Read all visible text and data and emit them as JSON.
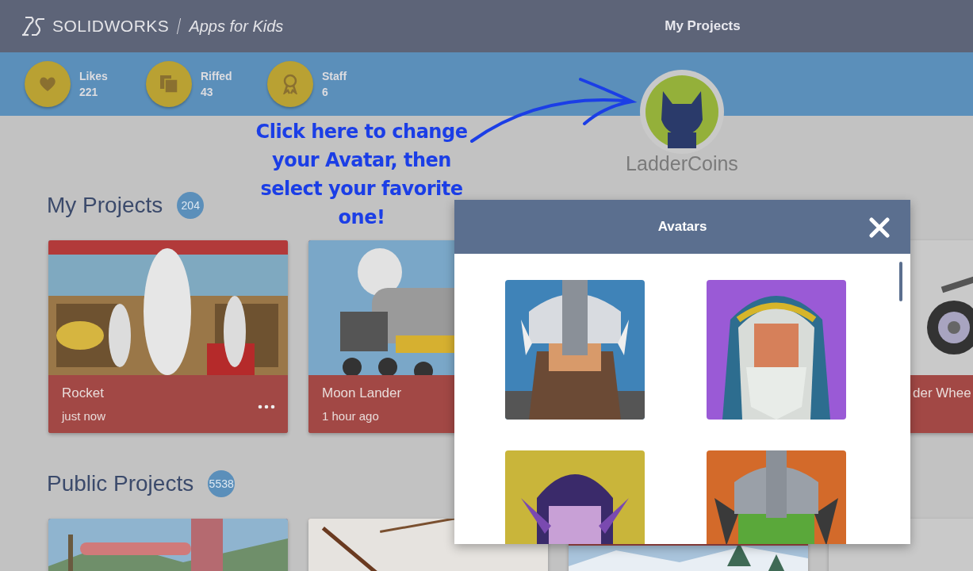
{
  "header": {
    "logo": "**SOLID**WORKS",
    "subtitle": "Apps for Kids",
    "title": "My Projects"
  },
  "stats": [
    {
      "kind": "likes",
      "label": "Likes",
      "value": "221"
    },
    {
      "kind": "riffed",
      "label": "Riffed",
      "value": "43"
    },
    {
      "kind": "staff",
      "label": "Staff",
      "value": "6"
    }
  ],
  "annotation": {
    "text": "Click here to change your Avatar, then select your favorite one!"
  },
  "profile": {
    "username": "LadderCoins"
  },
  "my_projects": {
    "title": "My Projects",
    "count": "204",
    "cards": [
      {
        "kind": "rocket",
        "title": "Rocket",
        "time": "just now",
        "menu": true
      },
      {
        "kind": "lander",
        "title": "Moon Lander",
        "time": "1 hour ago"
      },
      {
        "kind": "wheel",
        "title": "der Whee"
      }
    ]
  },
  "public_projects": {
    "title": "Public Projects",
    "count": "5538",
    "cards": [
      {
        "kind": "meadow"
      },
      {
        "kind": "violin"
      },
      {
        "kind": "snow"
      },
      {
        "kind": "tomato"
      }
    ]
  },
  "modal": {
    "title": "Avatars",
    "avatars": [
      {
        "kind": "viking"
      },
      {
        "kind": "wizard"
      },
      {
        "kind": "elf"
      },
      {
        "kind": "orc"
      }
    ]
  }
}
